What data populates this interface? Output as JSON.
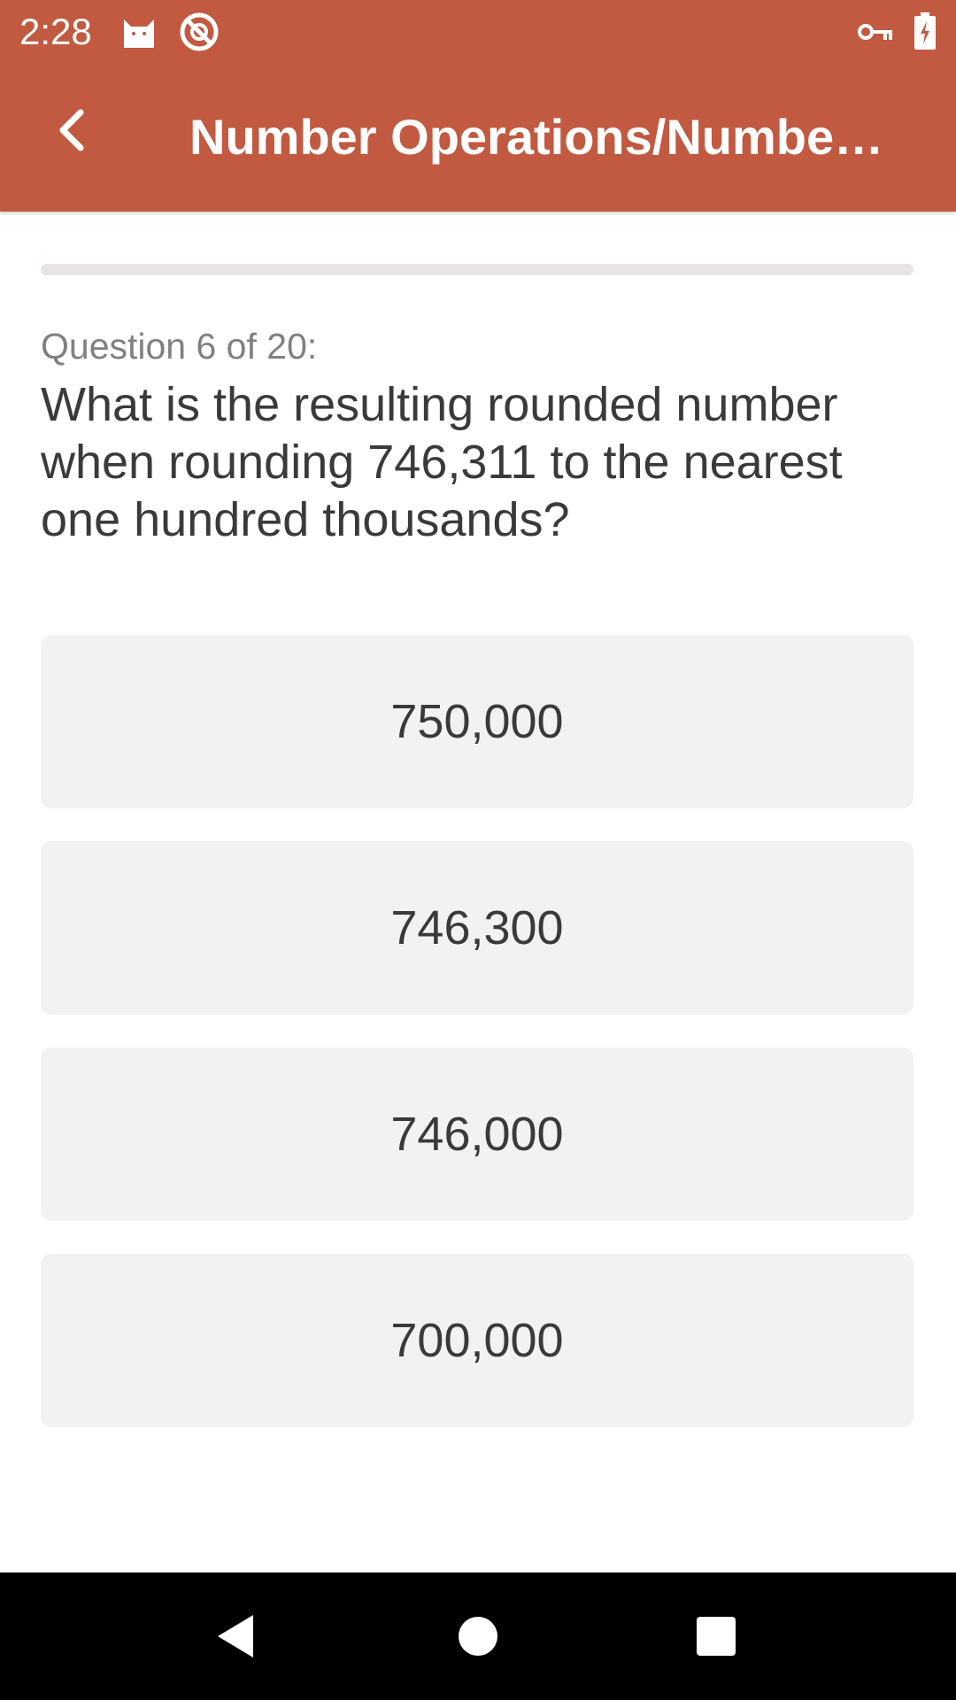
{
  "status_bar": {
    "time": "2:28",
    "icons": [
      "cat-icon",
      "no-sync-icon",
      "vpn-key-icon",
      "battery-charging-icon"
    ]
  },
  "app_bar": {
    "title": "Number Operations/Numbe…",
    "back_icon": "chevron-left-icon",
    "color": "#C15A41"
  },
  "quiz": {
    "progress_fraction": 0.0,
    "counter": "Question 6 of 20:",
    "question": "What is the resulting rounded number when rounding 746,311 to the nearest one hundred thousands?",
    "answers": [
      "750,000",
      "746,300",
      "746,000",
      "700,000"
    ]
  },
  "nav_bar": {
    "icons": [
      "back-triangle-icon",
      "home-circle-icon",
      "recents-square-icon"
    ]
  }
}
